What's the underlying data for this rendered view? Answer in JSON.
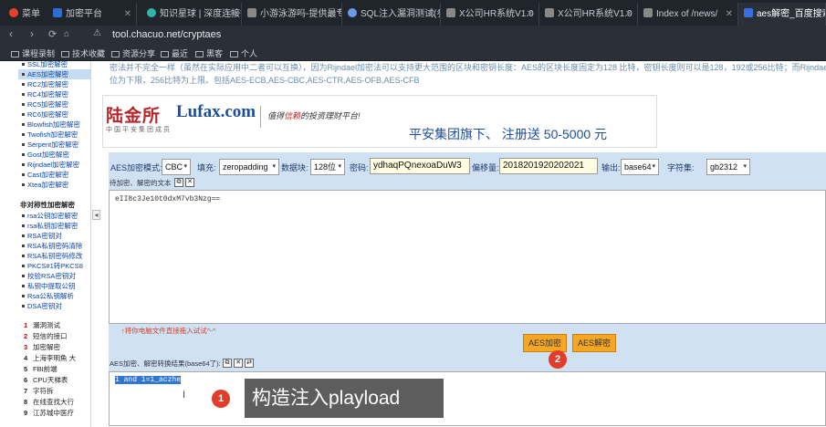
{
  "browser": {
    "tabs": [
      {
        "label": "菜单",
        "color": "#e8402a"
      },
      {
        "label": "加密平台",
        "color": "#2b6fd6"
      },
      {
        "label": "知识星球 | 深度连接铁",
        "color": "#2fb3a6"
      },
      {
        "label": "小游泳游吗-提供最专",
        "color": "#888888"
      },
      {
        "label": "SQL注入漏洞测试(参",
        "color": "#6a9ae8"
      },
      {
        "label": "X公司HR系统V1.0",
        "color": "#888888"
      },
      {
        "label": "X公司HR系统V1.0",
        "color": "#888888"
      },
      {
        "label": "Index of /news/",
        "color": "#888888"
      },
      {
        "label": "aes解密_百度搜索",
        "color": "#3a6fe0"
      }
    ],
    "url": "tool.chacuo.net/cryptaes",
    "bookmarks": [
      "课程录制",
      "技术收藏",
      "资源分享",
      "最近",
      "黑客",
      "个人"
    ]
  },
  "sidebar": {
    "sym_items": [
      "SSL加密解密",
      "AES加密解密",
      "RC2加密解密",
      "RC4加密解密",
      "RC5加密解密",
      "RC6加密解密",
      "Blowfish加密解密",
      "Twofish加密解密",
      "Serpent加密解密",
      "Gost加密解密",
      "Rijndael加密解密",
      "Cast加密解密",
      "Xtea加密解密"
    ],
    "asym_title": "非对称性加密解密",
    "asym_items": [
      "rsa公钥加密解密",
      "rsa私钥加密解密",
      "RSA密钥对",
      "RSA私钥密码清除",
      "RSA私钥密码修改",
      "PKCS#1转PKCS8",
      "校验RSA密钥对",
      "私钥中提取公钥",
      "Rsa公私钥解析",
      "DSA密钥对"
    ],
    "ranking": [
      {
        "n": "1",
        "t": "漏洞测试"
      },
      {
        "n": "2",
        "t": "短信的接口"
      },
      {
        "n": "3",
        "t": "加密解密"
      },
      {
        "n": "4",
        "t": "上海李明魚 大"
      },
      {
        "n": "5",
        "t": "FBI前端"
      },
      {
        "n": "6",
        "t": "CPU天梯表"
      },
      {
        "n": "7",
        "t": "字符拆"
      },
      {
        "n": "8",
        "t": "在线查找大行"
      },
      {
        "n": "9",
        "t": "江苏城中医疗"
      }
    ]
  },
  "description": {
    "line1": "密法并不完全一样（虽然在实际应用中二者可以互换），因为Rijndael加密法可以支持更大范围的区块和密钥长度：AES的区块长度固定为128 比特，密钥长度则可以是128，192或256比特；而Rijndael使用的密钥和区块长度可以是32",
    "line2": "位为下限，256比特为上限。包括AES-ECB,AES-CBC,AES-CTR,AES-OFB,AES-CFB"
  },
  "ad": {
    "logo_cn": "陆金所",
    "logo_en": "Lufax.com",
    "logo_sub": "中国平安集团成员",
    "slogan_pre": "值得",
    "slogan_em": "信赖",
    "slogan_post": "的投资理财平台!",
    "promo": "平安集团旗下、  注册送 50-5000 元"
  },
  "controls": {
    "mode_label": "AES加密模式:",
    "mode_value": "CBC",
    "padding_label": "填充:",
    "padding_value": "zeropadding",
    "blocksize_label": "数据块:",
    "blocksize_value": "128位",
    "key_label": "密码:",
    "key_value": "ydhaqPQnexoaDuW3",
    "iv_label": "偏移量:",
    "iv_value": "2018201920202021",
    "output_label": "输出:",
    "output_value": "base64",
    "charset_label": "字符集:",
    "charset_value": "gb2312"
  },
  "source": {
    "title": "待加密、解密的文本",
    "text": "eII8c3Je10t0dxM7vb3Nzg=="
  },
  "hint": "↑将你电脑文件直接拖入试试^-^",
  "buttons": {
    "encrypt": "AES加密",
    "decrypt": "AES解密"
  },
  "result": {
    "title": "AES加密、解密转换结果(base64了):",
    "text": "1 and 1=1_aczhe"
  },
  "annotations": {
    "badge1": "1",
    "badge2": "2",
    "callout": "构造注入playload"
  }
}
